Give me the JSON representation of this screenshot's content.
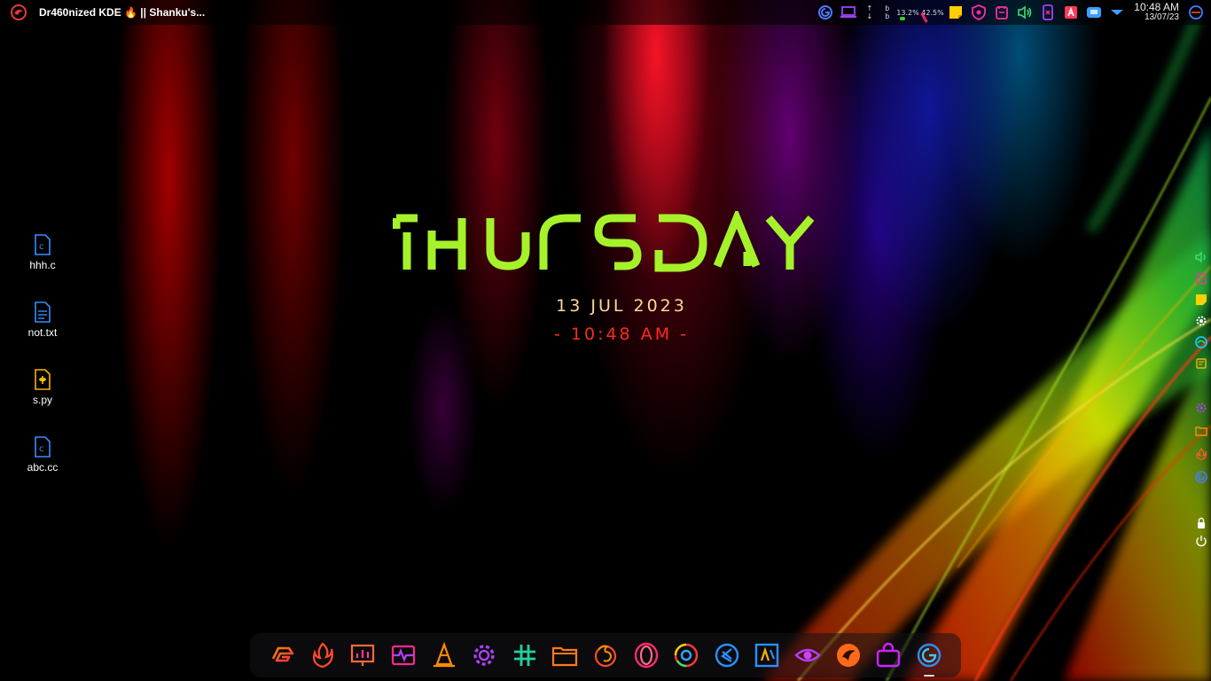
{
  "panel": {
    "window_title": "Dr460nized KDE 🔥 || Shanku's...",
    "net_up_arrow": "↑",
    "net_down_arrow": "↓",
    "net_up": "b",
    "net_down": "b",
    "cpu_percent": "13.2%",
    "mem_percent": "42.5%",
    "clock_time": "10:48 AM",
    "clock_date": "13/07/23",
    "tray_icons": [
      "garuda-icon",
      "laptop-icon",
      "network-speed-icon",
      "cpu-monitor-icon",
      "memory-monitor-icon",
      "sticky-note-icon",
      "shield-icon",
      "notes-icon",
      "volume-icon",
      "phone-connect-icon",
      "font-a-icon",
      "keyboard-layout-icon",
      "expand-tray-icon",
      "garuda-menu-icon"
    ]
  },
  "desktop_icons": [
    {
      "name": "hhh.c",
      "type": "c-file-icon"
    },
    {
      "name": "not.txt",
      "type": "text-file-icon"
    },
    {
      "name": "s.py",
      "type": "python-file-icon"
    },
    {
      "name": "abc.cc",
      "type": "cpp-file-icon"
    }
  ],
  "widget": {
    "day": "THURSDAY",
    "date": "13 JUL 2023",
    "time": "- 10:48 AM -"
  },
  "colors": {
    "day": "#a6f22a",
    "date": "#ffd79a",
    "time": "#ff2a1a"
  },
  "sidebar_icons": [
    "volume-icon",
    "notes-icon",
    "sticky-note-icon",
    "settings-icon",
    "edge-browser-icon",
    "notepad-icon",
    "system-settings-icon",
    "folder-icon",
    "garuda-fire-icon",
    "garuda-icon",
    "lock-icon",
    "power-icon"
  ],
  "dock": {
    "apps": [
      "garuda-welcome-icon",
      "garuda-fire-icon",
      "presentation-icon",
      "system-monitor-icon",
      "vlc-icon",
      "settings-gear-icon",
      "slack-hash-icon",
      "file-manager-icon",
      "firefox-icon",
      "opera-icon",
      "chrome-icon",
      "vscode-icon",
      "jetbrains-icon",
      "eye-icon",
      "garuda-dragon-icon",
      "store-bag-icon",
      "garuda-menu-icon"
    ],
    "active_app": "garuda-menu-icon"
  }
}
